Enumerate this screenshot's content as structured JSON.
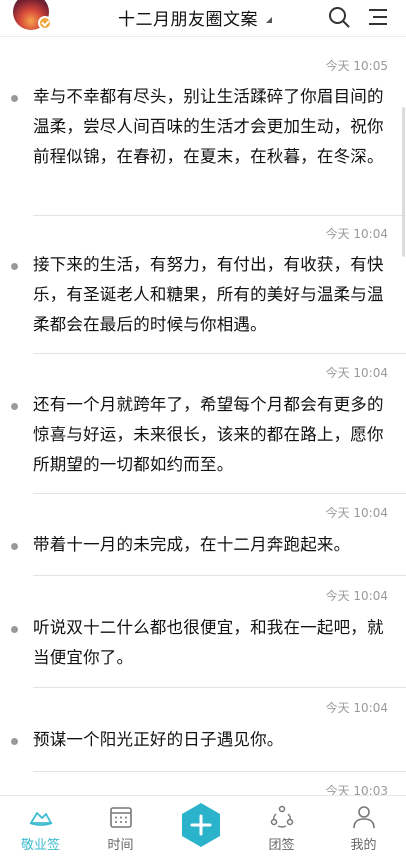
{
  "header": {
    "title": "十二月朋友圈文案",
    "icons": [
      "avatar",
      "verified-badge-icon",
      "dropdown-caret-icon",
      "search-icon",
      "menu-icon"
    ]
  },
  "feed": {
    "entries": [
      {
        "time": "今天 10:05",
        "text": "幸与不幸都有尽头，别让生活蹂碎了你眉目间的温柔，尝尽人间百味的生活才会更加生动，祝你前程似锦，在春初，在夏末，在秋暮，在冬深。"
      },
      {
        "time": "今天 10:04",
        "text": "接下来的生活，有努力，有付出，有收获，有快乐，有圣诞老人和糖果，所有的美好与温柔与温柔都会在最后的时候与你相遇。"
      },
      {
        "time": "今天 10:04",
        "text": "还有一个月就跨年了，希望每个月都会有更多的惊喜与好运，未来很长，该来的都在路上，愿你所期望的一切都如约而至。"
      },
      {
        "time": "今天 10:04",
        "text": "带着十一月的未完成，在十二月奔跑起来。"
      },
      {
        "time": "今天 10:04",
        "text": "听说双十二什么都也很便宜，和我在一起吧，就当便宜你了。"
      },
      {
        "time": "今天 10:04",
        "text": " 预谋一个阳光正好的日子遇见你。"
      },
      {
        "time": "今天 10:03",
        "text": ""
      }
    ]
  },
  "nav": {
    "items": [
      {
        "label": "敬业签",
        "icon": "cloud-note-icon"
      },
      {
        "label": "时间",
        "icon": "calendar-icon"
      },
      {
        "label": "",
        "icon": "add-icon"
      },
      {
        "label": "团签",
        "icon": "team-icon"
      },
      {
        "label": "我的",
        "icon": "profile-icon"
      }
    ]
  },
  "colors": {
    "accent": "#3dbccf",
    "fab": "#2bb3cc",
    "time_text": "#9a9a9a",
    "separator": "#e3e3e3"
  }
}
